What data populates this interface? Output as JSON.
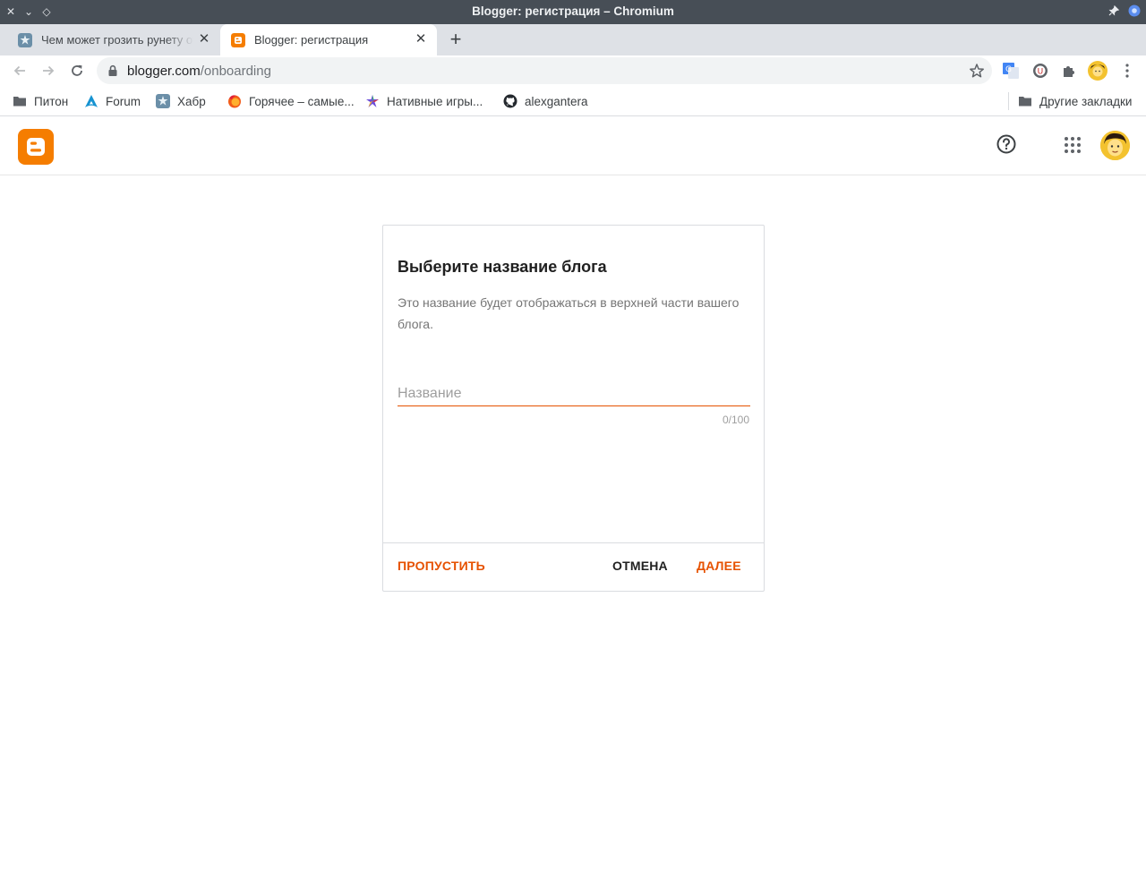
{
  "window": {
    "title": "Blogger: регистрация – Chromium"
  },
  "tabs": [
    {
      "title": "Чем может грозить рунету отключение",
      "active": false
    },
    {
      "title": "Blogger: регистрация",
      "active": true
    }
  ],
  "toolbar": {
    "url_host": "blogger.com",
    "url_path": "/onboarding"
  },
  "bookmarks": [
    {
      "label": "Питон",
      "icon": "folder-icon"
    },
    {
      "label": "Forum",
      "icon": "arch-icon"
    },
    {
      "label": "Хабр",
      "icon": "habr-icon"
    },
    {
      "label": "Горячее – самые...",
      "icon": "firefox-icon"
    },
    {
      "label": "Нативные игры...",
      "icon": "star-burst-icon"
    },
    {
      "label": "alexgantera",
      "icon": "github-icon"
    }
  ],
  "other_bookmarks": "Другие закладки",
  "dialog": {
    "title": "Выберите название блога",
    "description": "Это название будет отображаться в верхней части вашего блога.",
    "input_value": "",
    "input_placeholder": "Название",
    "counter": "0/100",
    "skip_label": "ПРОПУСТИТЬ",
    "cancel_label": "ОТМЕНА",
    "next_label": "ДАЛЕЕ"
  },
  "colors": {
    "accent": "#e65100",
    "blogger_orange": "#f57d00"
  }
}
